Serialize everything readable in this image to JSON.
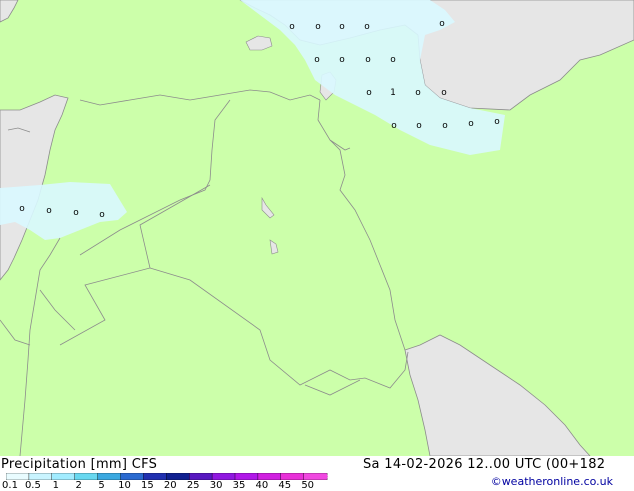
{
  "colors": {
    "land": "#ccffaa",
    "sea": "#e6e6e6",
    "precip_light": "#d9f8ff",
    "border": "#8c8c8c",
    "credit": "#0000a0"
  },
  "map": {
    "marker_symbol": "o",
    "marker_value_label": "1"
  },
  "legend": {
    "title_left": "Precipitation [mm]  CFS",
    "title_right": "Sa 14-02-2026 12..00 UTC (00+182",
    "tick_labels": [
      "0.1",
      "0.5",
      "1",
      "2",
      "5",
      "10",
      "15",
      "20",
      "25",
      "30",
      "35",
      "40",
      "45",
      "50"
    ],
    "scale_colors": [
      "#e9fcff",
      "#c9f4ff",
      "#a2ecff",
      "#68d8f0",
      "#3aa8e0",
      "#2a6ad0",
      "#2030b0",
      "#102090",
      "#5818c0",
      "#9018e0",
      "#b018e8",
      "#d020e0",
      "#e830d8",
      "#f048e0"
    ],
    "credit": "©weatheronline.co.uk"
  }
}
